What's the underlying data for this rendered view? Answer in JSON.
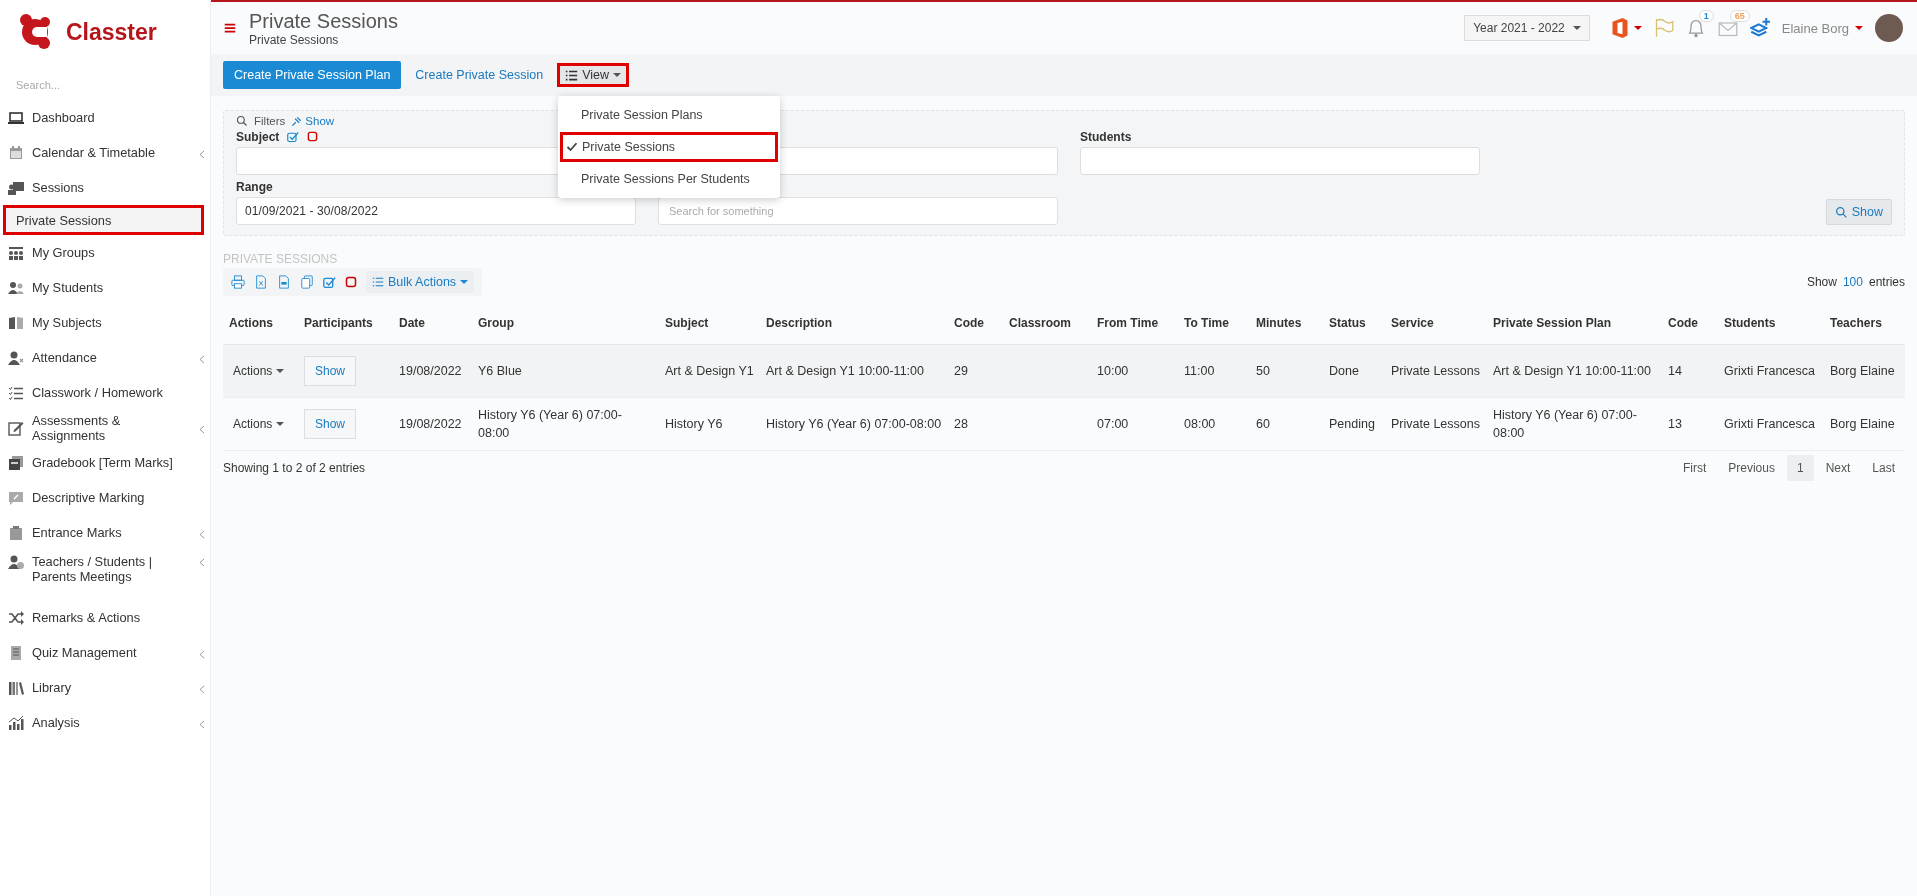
{
  "brand": {
    "name": "Classter"
  },
  "sidebar": {
    "search_placeholder": "Search...",
    "items": [
      {
        "label": "Dashboard",
        "selected": false,
        "has_submenu": false
      },
      {
        "label": "Calendar & Timetable",
        "selected": false,
        "has_submenu": true
      },
      {
        "label": "Sessions",
        "selected": false,
        "has_submenu": false
      },
      {
        "label": "Private Sessions",
        "selected": true,
        "has_submenu": false
      },
      {
        "label": "My Groups",
        "selected": false,
        "has_submenu": false
      },
      {
        "label": "My Students",
        "selected": false,
        "has_submenu": false
      },
      {
        "label": "My Subjects",
        "selected": false,
        "has_submenu": false
      },
      {
        "label": "Attendance",
        "selected": false,
        "has_submenu": true
      },
      {
        "label": "Classwork / Homework",
        "selected": false,
        "has_submenu": false
      },
      {
        "label": "Assessments & Assignments",
        "selected": false,
        "has_submenu": true
      },
      {
        "label": "Gradebook [Term Marks]",
        "selected": false,
        "has_submenu": false
      },
      {
        "label": "Descriptive Marking",
        "selected": false,
        "has_submenu": false
      },
      {
        "label": "Entrance Marks",
        "selected": false,
        "has_submenu": true
      },
      {
        "label": "Teachers / Students | Parents Meetings",
        "selected": false,
        "has_submenu": true
      },
      {
        "label": "Remarks & Actions",
        "selected": false,
        "has_submenu": false
      },
      {
        "label": "Quiz Management",
        "selected": false,
        "has_submenu": true
      },
      {
        "label": "Library",
        "selected": false,
        "has_submenu": true
      },
      {
        "label": "Analysis",
        "selected": false,
        "has_submenu": true
      }
    ]
  },
  "header": {
    "title": "Private Sessions",
    "breadcrumb": "Private Sessions",
    "year": "Year 2021 - 2022",
    "notifications": "1",
    "messages": "65",
    "user": "Elaine Borg"
  },
  "toolbar": {
    "primary_button": "Create Private Session Plan",
    "link": "Create Private Session",
    "view_button": "View",
    "view_expanded": true,
    "view_menu": [
      {
        "label": "Private Session Plans",
        "selected": false
      },
      {
        "label": "Private Sessions",
        "selected": true
      },
      {
        "label": "Private Sessions Per Students",
        "selected": false
      }
    ]
  },
  "filters": {
    "legend": "Filters",
    "toggle": "Show",
    "fields": [
      {
        "kind": "text",
        "label": "Subject"
      },
      {
        "kind": "text"
      },
      {
        "kind": "text",
        "label": "Students"
      },
      {
        "kind": "date_range",
        "label": "Range",
        "value": "01/09/2021 - 30/08/2022"
      },
      {
        "kind": "search",
        "placeholder": "Search for something"
      }
    ],
    "show_button": "Show"
  },
  "table": {
    "title": "PRIVATE SESSIONS",
    "bulk_actions": "Bulk Actions",
    "length": {
      "before": "Show",
      "value": "100",
      "after": "entries"
    },
    "columns": [
      "Actions",
      "Participants",
      "Date",
      "Group",
      "Subject",
      "Description",
      "Code",
      "Classroom",
      "From Time",
      "To Time",
      "Minutes",
      "Status",
      "Service",
      "Private Session Plan",
      "Code",
      "Students",
      "Teachers"
    ],
    "rows": [
      {
        "cells": [
          "Actions",
          "Show",
          "19/08/2022",
          "Y6 Blue",
          "Art & Design Y1",
          "Art & Design Y1 10:00-11:00",
          "29",
          "",
          "10:00",
          "11:00",
          "50",
          "Done",
          "Private Lessons",
          "Art & Design Y1 10:00-11:00",
          "14",
          "Grixti Francesca",
          "Borg Elaine"
        ]
      },
      {
        "cells": [
          "Actions",
          "Show",
          "19/08/2022",
          "History Y6 (Year 6) 07:00-08:00",
          "History Y6",
          "History Y6 (Year 6) 07:00-08:00",
          "28",
          "",
          "07:00",
          "08:00",
          "60",
          "Pending",
          "Private Lessons",
          "History Y6 (Year 6) 07:00-08:00",
          "13",
          "Grixti Francesca",
          "Borg Elaine"
        ]
      }
    ],
    "info": "Showing 1 to 2 of 2 entries",
    "pagination": [
      {
        "label": "First",
        "selected": false
      },
      {
        "label": "Previous",
        "selected": false
      },
      {
        "label": "1",
        "selected": true
      },
      {
        "label": "Next",
        "selected": false
      },
      {
        "label": "Last",
        "selected": false
      }
    ]
  }
}
